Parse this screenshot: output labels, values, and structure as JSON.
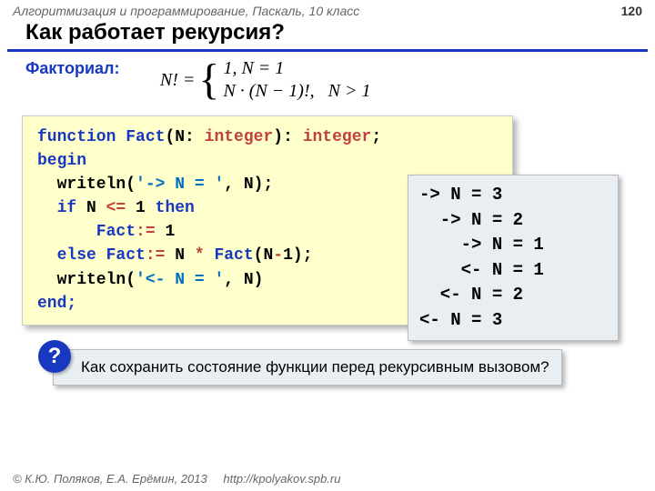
{
  "header": {
    "course": "Алгоритмизация и программирование, Паскаль, 10 класс",
    "page": "120"
  },
  "title": "Как работает рекурсия?",
  "subtitle": "Факториал:",
  "formula": {
    "lhs": "N! =",
    "case1": "1,    N = 1",
    "case2_a": "N · (N − 1)!, ",
    "case2_b": "N > 1"
  },
  "code": {
    "l1a": "function",
    "l1b": " Fact",
    "l1c": "(N: ",
    "l1d": "integer",
    "l1e": "): ",
    "l1f": "integer",
    "l1g": ";",
    "l2": "begin",
    "l3a": "  writeln(",
    "l3b": "'-> N = '",
    "l3c": ", N);",
    "l4a": "  if",
    "l4b": " N ",
    "l4c": "<=",
    "l4d": " 1 ",
    "l4e": "then",
    "l5a": "      Fact",
    "l5b": ":=",
    "l5c": " 1",
    "l6a": "  else",
    "l6b": " Fact",
    "l6c": ":=",
    "l6d": " N ",
    "l6e": "*",
    "l6f": " Fact",
    "l6g": "(N",
    "l6h": "-",
    "l6i": "1);",
    "l7a": "  writeln(",
    "l7b": "'<- N = '",
    "l7c": ", N)",
    "l8": "end;"
  },
  "trace": {
    "t1": "-> N = 3",
    "t2": "  -> N = 2",
    "t3": "    -> N = 1",
    "t4": "    <- N = 1",
    "t5": "  <- N = 2",
    "t6": "<- N = 3"
  },
  "question": {
    "mark": "?",
    "text": "Как сохранить состояние функции перед рекурсивным вызовом?"
  },
  "footer": {
    "copyright": "© К.Ю. Поляков, Е.А. Ерёмин, 2013",
    "url": "http://kpolyakov.spb.ru"
  }
}
